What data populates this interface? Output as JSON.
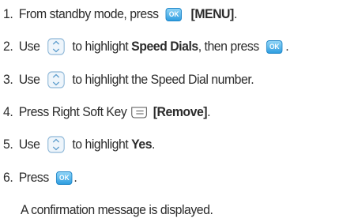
{
  "steps": [
    {
      "num": "1.",
      "a": "From standby mode, press",
      "key": "OK",
      "b": "[MENU]",
      "c": "."
    },
    {
      "num": "2.",
      "a": "Use",
      "a2": "to highlight",
      "b": "Speed Dials",
      "c": ", then press",
      "key": "OK",
      "d": "."
    },
    {
      "num": "3.",
      "a": "Use",
      "a2": "to highlight the Speed Dial number."
    },
    {
      "num": "4.",
      "a": "Press Right Soft Key",
      "b": "[Remove]",
      "c": "."
    },
    {
      "num": "5.",
      "a": "Use",
      "a2": "to highlight",
      "b": "Yes",
      "c": "."
    },
    {
      "num": "6.",
      "a": "Press",
      "key": "OK",
      "c": "."
    }
  ],
  "note": "A confirmation message is displayed.",
  "icons": {
    "ok": "ok-key-icon",
    "nav": "nav-up-down-key-icon",
    "soft": "right-soft-key-icon"
  },
  "colors": {
    "ok_key": "#2f9ee0",
    "nav_key": "#8fb8d8",
    "text": "#2b2b2b"
  }
}
